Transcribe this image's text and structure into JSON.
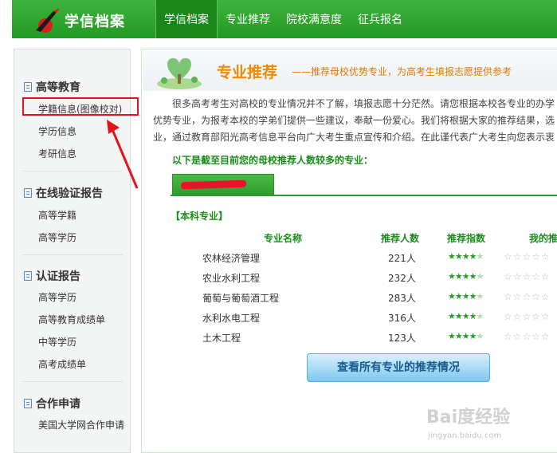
{
  "brand": {
    "title": "学信档案",
    "accent": "#2aa52a"
  },
  "nav": {
    "items": [
      {
        "label": "学信档案",
        "active": true
      },
      {
        "label": "专业推荐",
        "active": false
      },
      {
        "label": "院校满意度",
        "active": false
      },
      {
        "label": "征兵报名",
        "active": false
      }
    ]
  },
  "sidebar": {
    "sections": [
      {
        "title": "高等教育",
        "items": [
          "学籍信息(图像校对)",
          "学历信息",
          "考研信息"
        ]
      },
      {
        "title": "在线验证报告",
        "items": [
          "高等学籍",
          "高等学历"
        ]
      },
      {
        "title": "认证报告",
        "items": [
          "高等学历",
          "高等教育成绩单",
          "中等学历",
          "高考成绩单"
        ]
      },
      {
        "title": "合作申请",
        "items": [
          "美国大学网合作申请"
        ]
      }
    ]
  },
  "main": {
    "banner_title": "专业推荐",
    "banner_subtitle": "——推荐母校优势专业，为高考生填报志愿提供参考",
    "intro_lines": [
      "很多高考考生对高校的专业情况并不了解，填报志愿十分茫然。请您根据本校各专业的办学",
      "优势专业，为报考本校的学弟们提供一些建议，奉献一份爱心。我们将根据大家的推荐结果，选",
      "业，通过教育部阳光高考信息平台向广大考生重点宣传和介绍。在此谨代表广大考生向您表示衷"
    ],
    "list_heading": "以下是截至目前您的母校推荐人数较多的专业：",
    "category": "【本科专业】",
    "columns": {
      "name": "专业名称",
      "count": "推荐人数",
      "index": "推荐指数",
      "mine": "我的推"
    },
    "rows": [
      {
        "name": "农林经济管理",
        "count": "221人",
        "stars": 4
      },
      {
        "name": "农业水利工程",
        "count": "232人",
        "stars": 4
      },
      {
        "name": "葡萄与葡萄酒工程",
        "count": "283人",
        "stars": 4
      },
      {
        "name": "水利水电工程",
        "count": "316人",
        "stars": 4
      },
      {
        "name": "土木工程",
        "count": "123人",
        "stars": 4
      }
    ],
    "view_all_button": "查看所有专业的推荐情况"
  },
  "watermark": {
    "text": "Bai度经验",
    "url": "jingyan.baidu.com"
  },
  "colors": {
    "highlight": "#e3141b",
    "green": "#1a8c1a",
    "star": "#2b9a2b"
  }
}
